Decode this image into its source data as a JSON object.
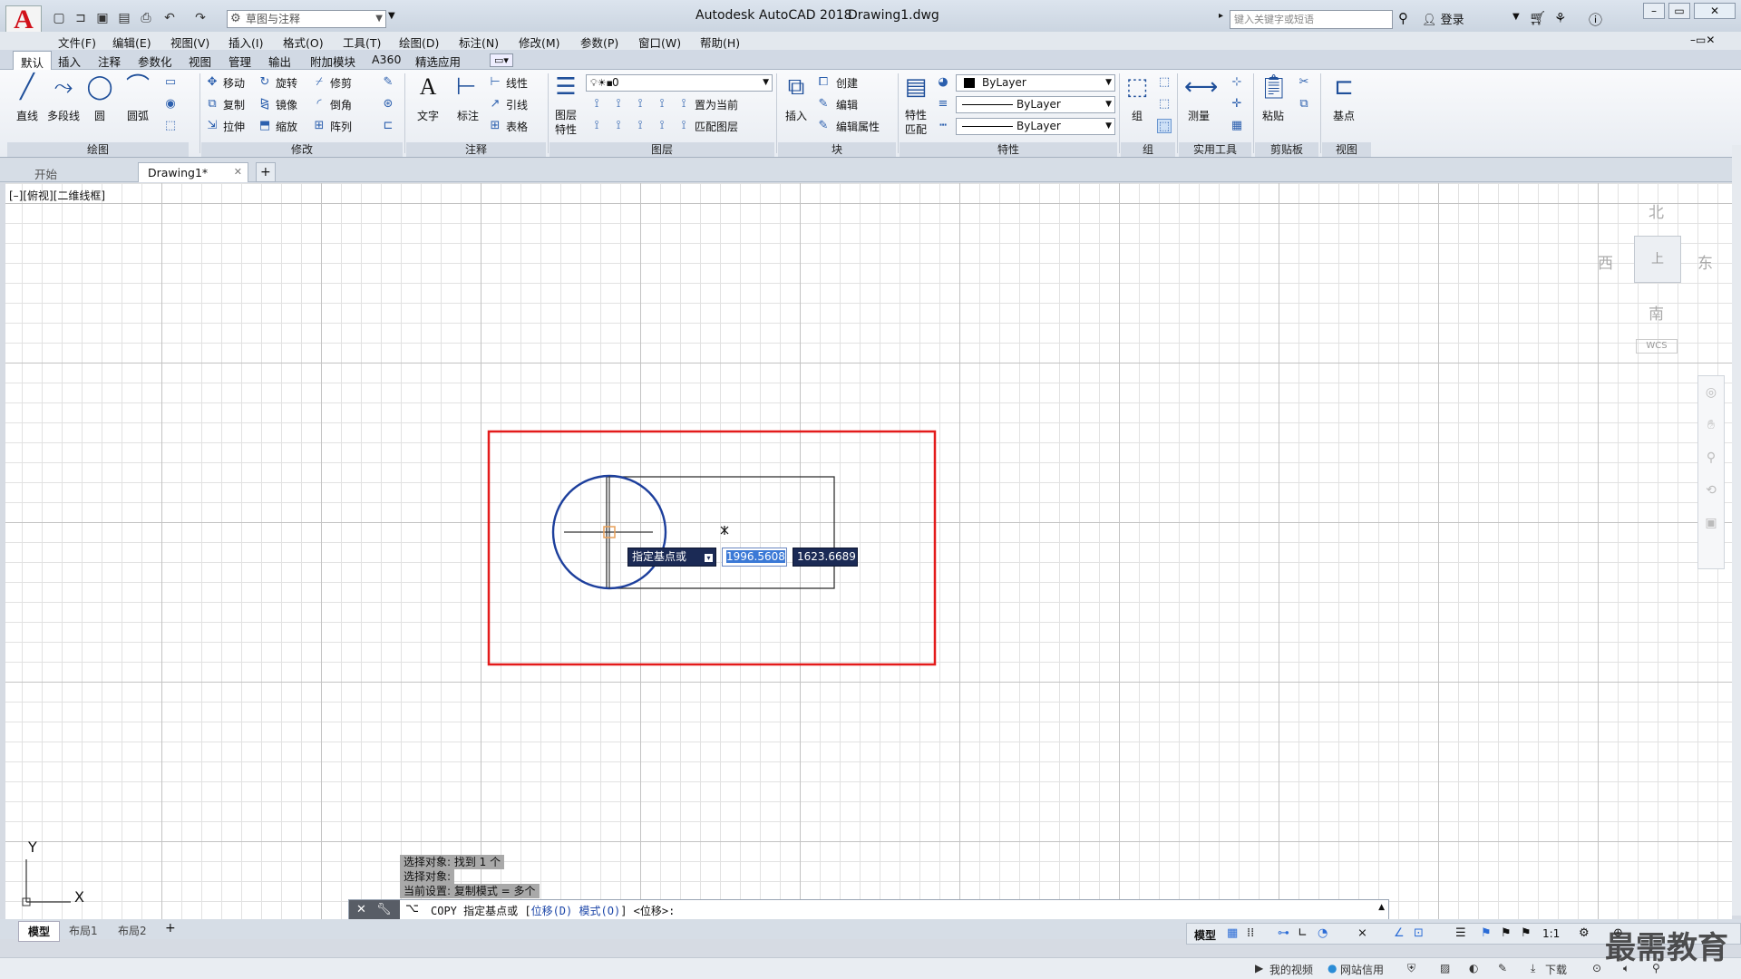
{
  "titlebar": {
    "app_logo": "A",
    "workspace": "草图与注释",
    "app_title": "Autodesk AutoCAD 2018",
    "file_title": "Drawing1.dwg",
    "search_placeholder": "键入关键字或短语",
    "login": "登录"
  },
  "menu": [
    "文件(F)",
    "编辑(E)",
    "视图(V)",
    "插入(I)",
    "格式(O)",
    "工具(T)",
    "绘图(D)",
    "标注(N)",
    "修改(M)",
    "参数(P)",
    "窗口(W)",
    "帮助(H)"
  ],
  "ribbon_tabs": [
    "默认",
    "插入",
    "注释",
    "参数化",
    "视图",
    "管理",
    "输出",
    "附加模块",
    "A360",
    "精选应用"
  ],
  "ribbon": {
    "draw": {
      "line": "直线",
      "polyline": "多段线",
      "circle": "圆",
      "arc": "圆弧",
      "title": "绘图"
    },
    "modify": {
      "move": "移动",
      "rotate": "旋转",
      "trim": "修剪",
      "copy": "复制",
      "mirror": "镜像",
      "fillet": "倒角",
      "stretch": "拉伸",
      "scale": "缩放",
      "array": "阵列",
      "title": "修改"
    },
    "annotation": {
      "text": "文字",
      "dimension": "标注",
      "linear": "线性",
      "leader": "引线",
      "table": "表格",
      "title": "注释"
    },
    "layers": {
      "properties": "图层\n特性",
      "layer_name": "0",
      "set_current": "置为当前",
      "match_layer": "匹配图层",
      "title": "图层"
    },
    "block": {
      "insert": "插入",
      "create": "创建",
      "edit": "编辑",
      "edit_attr": "编辑属性",
      "title": "块"
    },
    "properties": {
      "match": "特性\n匹配",
      "color": "ByLayer",
      "linetype": "ByLayer",
      "lineweight": "ByLayer",
      "title": "特性"
    },
    "groups": {
      "group": "组",
      "title": "组"
    },
    "utilities": {
      "measure": "测量",
      "title": "实用工具"
    },
    "clipboard": {
      "paste": "粘贴",
      "title": "剪贴板"
    },
    "view": {
      "base": "基点",
      "title": "视图"
    }
  },
  "doc_tabs": {
    "start": "开始",
    "drawing": "Drawing1*"
  },
  "viewport_label": "[–][俯视][二维线框]",
  "viewcube": {
    "north": "北",
    "south": "南",
    "east": "东",
    "west": "西",
    "top": "上",
    "wcs": "WCS"
  },
  "ucs": {
    "x": "X",
    "y": "Y"
  },
  "dynamic_input": {
    "prompt": "指定基点或",
    "x_value": "1996.5608",
    "y_value": "1623.6689"
  },
  "command_history": [
    "选择对象: 找到 1 个",
    "选择对象:",
    "当前设置:  复制模式 = 多个"
  ],
  "command_line": {
    "prefix": "COPY 指定基点或 [",
    "opt1": "位移(D)",
    "mid": " ",
    "opt2": "模式(O)",
    "suffix": "] <位移>:"
  },
  "layout_tabs": [
    "模型",
    "布局1",
    "布局2"
  ],
  "status": {
    "model": "模型",
    "scale": "1:1"
  },
  "taskbar": {
    "videos": "我的视频",
    "credit": "网站信用",
    "download": "下载",
    "watermark": "最需教育"
  },
  "colors": {
    "selection_rect": "#e31b1b",
    "circle": "#1d3f9c",
    "dyn_bg": "#1b2a55"
  }
}
